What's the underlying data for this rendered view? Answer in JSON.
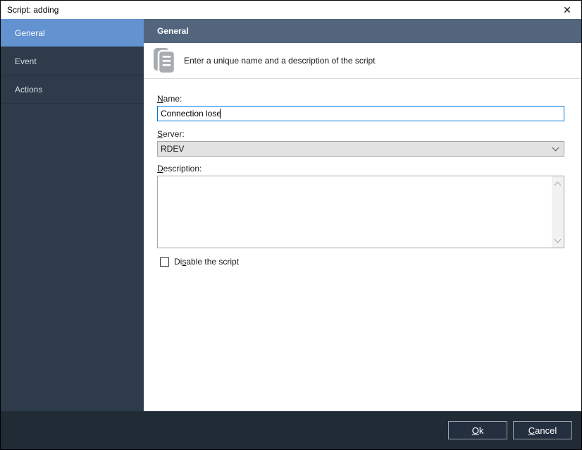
{
  "window": {
    "title": "Script: adding",
    "close_glyph": "✕"
  },
  "sidebar": {
    "items": [
      {
        "label": "General",
        "selected": true
      },
      {
        "label": "Event",
        "selected": false
      },
      {
        "label": "Actions",
        "selected": false
      }
    ]
  },
  "header": {
    "title": "General"
  },
  "hero": {
    "icon": "script-pages-icon",
    "text": "Enter a unique name and a description of the script"
  },
  "form": {
    "name": {
      "label": {
        "pre": "",
        "key": "N",
        "post": "ame:"
      },
      "value": "Connection lose"
    },
    "server": {
      "label": {
        "pre": "",
        "key": "S",
        "post": "erver:"
      },
      "value": "RDEV"
    },
    "description": {
      "label": {
        "pre": "",
        "key": "D",
        "post": "escription:"
      },
      "value": ""
    },
    "disable": {
      "label": {
        "pre": "Di",
        "key": "s",
        "post": "able the script"
      },
      "checked": false
    }
  },
  "footer": {
    "ok": {
      "pre": "",
      "key": "O",
      "post": "k"
    },
    "cancel": {
      "pre": "",
      "key": "C",
      "post": "ancel"
    }
  },
  "colors": {
    "sidebar_bg": "#2d3b4a",
    "selected_item": "#6292d0",
    "header_bar": "#53657d",
    "footer_bar": "#202b36",
    "focus_border": "#0077d6",
    "icon_gray": "#a7acb1"
  }
}
